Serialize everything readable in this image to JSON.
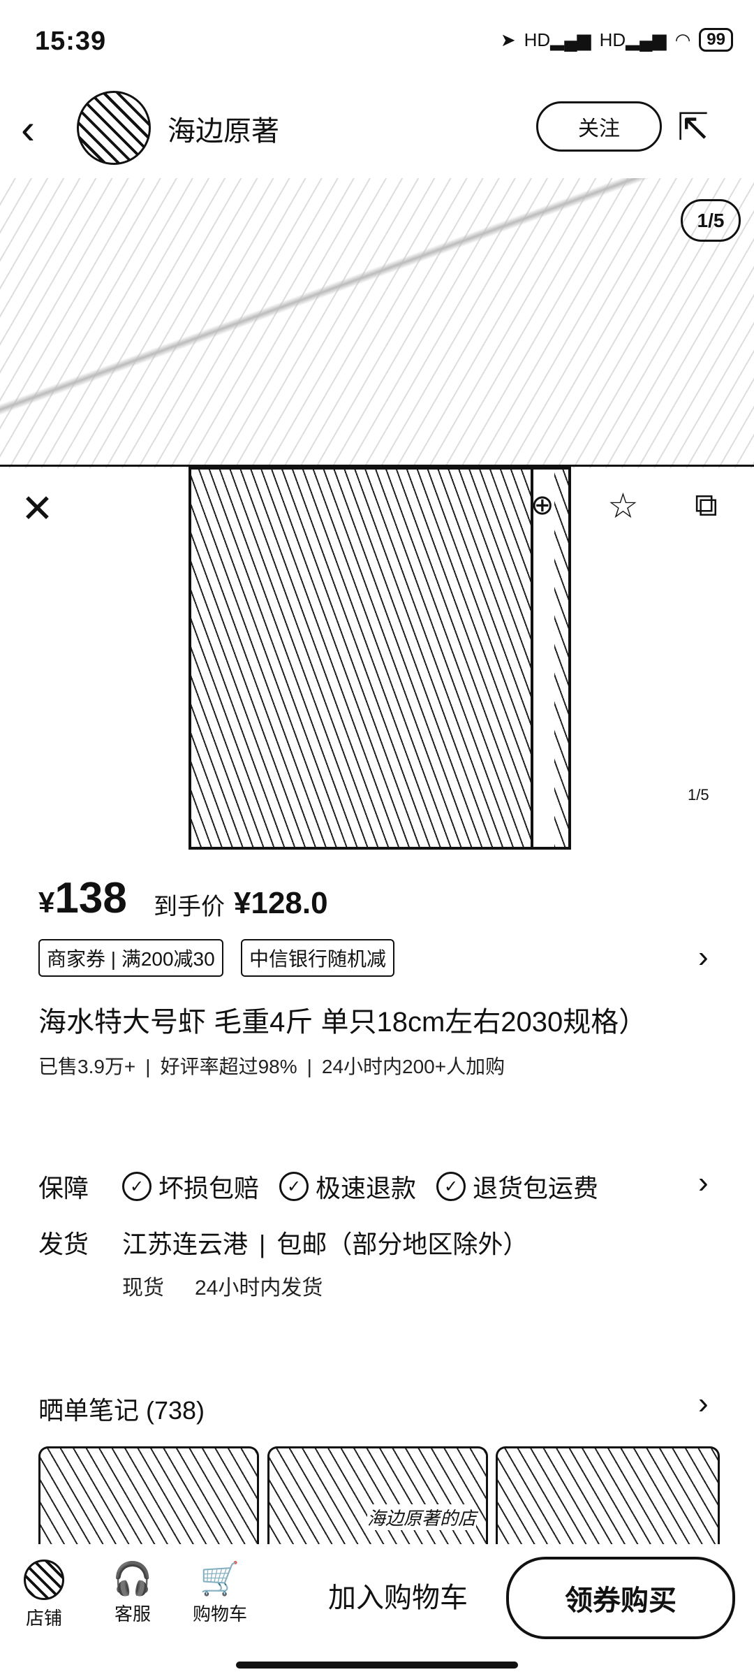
{
  "status_bar": {
    "time": "15:39",
    "battery": "99",
    "signal_labels": [
      "HD",
      "HD"
    ]
  },
  "header": {
    "shop_name": "海边原著",
    "follow_label": "关注"
  },
  "gallery": {
    "pager": "1/5",
    "small_pager": "1/5"
  },
  "price": {
    "currency": "¥",
    "amount": "138",
    "deal_label": "到手价",
    "deal_price": "¥128.0"
  },
  "coupons": [
    "商家券 | 满200减30",
    "中信银行随机减"
  ],
  "product": {
    "title": "海水特大号虾 毛重4斤 单只18cm左右2030规格）",
    "sold": "已售3.9万+",
    "rating": "好评率超过98%",
    "added": "24小时内200+人加购"
  },
  "guarantee": {
    "label": "保障",
    "items": [
      "坏损包赔",
      "极速退款",
      "退货包运费"
    ]
  },
  "shipping": {
    "label": "发货",
    "origin": "江苏连云港",
    "policy": "包邮（部分地区除外）",
    "stock": "现货",
    "dispatch": "24小时内发货"
  },
  "notes": {
    "title": "晒单笔记 (738)",
    "thumb_caption": "海边原著的店"
  },
  "bottom_bar": {
    "store": "店铺",
    "service": "客服",
    "cart": "购物车",
    "add_to_cart": "加入购物车",
    "buy": "领券购买"
  }
}
